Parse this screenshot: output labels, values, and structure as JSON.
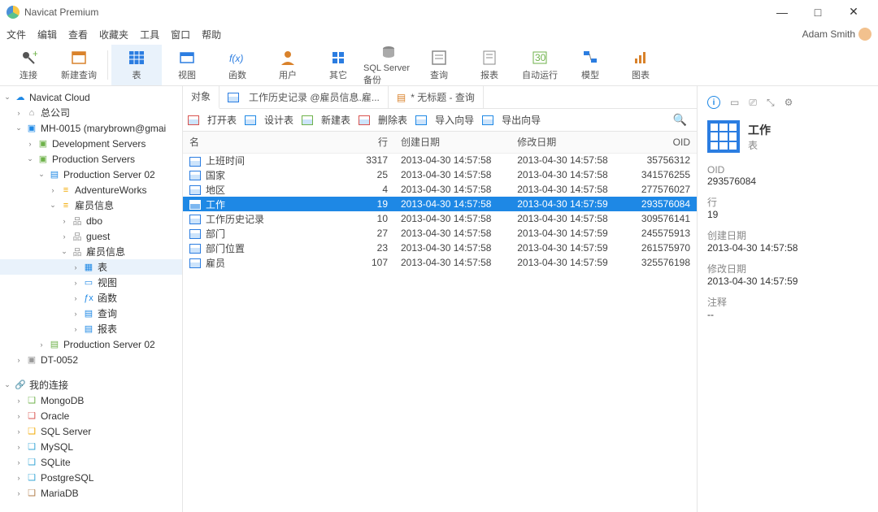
{
  "titlebar": {
    "title": "Navicat Premium"
  },
  "menubar": {
    "items": [
      "文件",
      "编辑",
      "查看",
      "收藏夹",
      "工具",
      "窗口",
      "帮助"
    ],
    "user": "Adam Smith"
  },
  "toolbar": [
    {
      "label": "连接",
      "icon": "plug-icon"
    },
    {
      "label": "新建查询",
      "icon": "query-icon"
    },
    {
      "label": "表",
      "icon": "table-icon",
      "active": true
    },
    {
      "label": "视图",
      "icon": "view-icon"
    },
    {
      "label": "函数",
      "icon": "fx-icon"
    },
    {
      "label": "用户",
      "icon": "user-icon"
    },
    {
      "label": "其它",
      "icon": "other-icon"
    },
    {
      "label": "SQL Server 备份",
      "icon": "backup-icon"
    },
    {
      "label": "查询",
      "icon": "query2-icon"
    },
    {
      "label": "报表",
      "icon": "report-icon"
    },
    {
      "label": "自动运行",
      "icon": "auto-icon"
    },
    {
      "label": "模型",
      "icon": "model-icon"
    },
    {
      "label": "图表",
      "icon": "chart-icon"
    }
  ],
  "tree": {
    "sections": [
      {
        "label": "Navicat Cloud",
        "icon": "cloud"
      },
      {
        "label": "总公司",
        "indent": 1,
        "icon": "org"
      },
      {
        "label": "MH-0015",
        "suffix": "(marybrown@gmai",
        "indent": 1,
        "icon": "laptop",
        "expanded": true
      },
      {
        "label": "Development Servers",
        "indent": 2,
        "icon": "folder"
      },
      {
        "label": "Production Servers",
        "indent": 2,
        "icon": "folder",
        "expanded": true
      },
      {
        "label": "Production Server 02",
        "indent": 3,
        "icon": "server",
        "expanded": true
      },
      {
        "label": "AdventureWorks",
        "indent": 4,
        "icon": "db"
      },
      {
        "label": "雇员信息",
        "indent": 4,
        "icon": "db",
        "expanded": true
      },
      {
        "label": "dbo",
        "indent": 5,
        "icon": "schema"
      },
      {
        "label": "guest",
        "indent": 5,
        "icon": "schema"
      },
      {
        "label": "雇员信息",
        "indent": 5,
        "icon": "schema",
        "expanded": true
      },
      {
        "label": "表",
        "indent": 6,
        "icon": "table",
        "selected": true
      },
      {
        "label": "视图",
        "indent": 6,
        "icon": "view"
      },
      {
        "label": "函数",
        "indent": 6,
        "icon": "fx"
      },
      {
        "label": "查询",
        "indent": 6,
        "icon": "query"
      },
      {
        "label": "报表",
        "indent": 6,
        "icon": "report"
      },
      {
        "label": "Production Server 02",
        "indent": 3,
        "icon": "server-green"
      },
      {
        "label": "DT-0052",
        "indent": 1,
        "icon": "laptop-grey"
      },
      {
        "spacer": true
      },
      {
        "label": "我的连接",
        "icon": "link",
        "expanded": true
      },
      {
        "label": "MongoDB",
        "indent": 1,
        "icon": "mongo"
      },
      {
        "label": "Oracle",
        "indent": 1,
        "icon": "oracle"
      },
      {
        "label": "SQL Server",
        "indent": 1,
        "icon": "mssql"
      },
      {
        "label": "MySQL",
        "indent": 1,
        "icon": "mysql"
      },
      {
        "label": "SQLite",
        "indent": 1,
        "icon": "sqlite"
      },
      {
        "label": "PostgreSQL",
        "indent": 1,
        "icon": "pg"
      },
      {
        "label": "MariaDB",
        "indent": 1,
        "icon": "maria"
      }
    ]
  },
  "tabs": [
    {
      "label": "对象",
      "active": true,
      "icon": "obj"
    },
    {
      "label": "工作历史记录 @雇员信息.雇...",
      "icon": "tbl"
    },
    {
      "label": "* 无标题 - 查询",
      "icon": "qry"
    }
  ],
  "subtoolbar": [
    {
      "label": "打开表",
      "icon": "open"
    },
    {
      "label": "设计表",
      "icon": "design"
    },
    {
      "label": "新建表",
      "icon": "new"
    },
    {
      "label": "删除表",
      "icon": "del"
    },
    {
      "label": "导入向导",
      "icon": "imp"
    },
    {
      "label": "导出向导",
      "icon": "exp"
    }
  ],
  "columns": [
    "名",
    "行",
    "创建日期",
    "修改日期",
    "OID"
  ],
  "rows": [
    {
      "name": "上班时间",
      "rows": 3317,
      "created": "2013-04-30 14:57:58",
      "modified": "2013-04-30 14:57:58",
      "oid": "35756312"
    },
    {
      "name": "国家",
      "rows": 25,
      "created": "2013-04-30 14:57:58",
      "modified": "2013-04-30 14:57:58",
      "oid": "341576255"
    },
    {
      "name": "地区",
      "rows": 4,
      "created": "2013-04-30 14:57:58",
      "modified": "2013-04-30 14:57:58",
      "oid": "277576027"
    },
    {
      "name": "工作",
      "rows": 19,
      "created": "2013-04-30 14:57:58",
      "modified": "2013-04-30 14:57:59",
      "oid": "293576084",
      "selected": true
    },
    {
      "name": "工作历史记录",
      "rows": 10,
      "created": "2013-04-30 14:57:58",
      "modified": "2013-04-30 14:57:58",
      "oid": "309576141"
    },
    {
      "name": "部门",
      "rows": 27,
      "created": "2013-04-30 14:57:58",
      "modified": "2013-04-30 14:57:59",
      "oid": "245575913"
    },
    {
      "name": "部门位置",
      "rows": 23,
      "created": "2013-04-30 14:57:58",
      "modified": "2013-04-30 14:57:59",
      "oid": "261575970"
    },
    {
      "name": "雇员",
      "rows": 107,
      "created": "2013-04-30 14:57:58",
      "modified": "2013-04-30 14:57:59",
      "oid": "325576198"
    }
  ],
  "details": {
    "title": "工作",
    "subtitle": "表",
    "fields": [
      {
        "k": "OID",
        "v": "293576084"
      },
      {
        "k": "行",
        "v": "19"
      },
      {
        "k": "创建日期",
        "v": "2013-04-30 14:57:58"
      },
      {
        "k": "修改日期",
        "v": "2013-04-30 14:57:59"
      },
      {
        "k": "注释",
        "v": "--"
      }
    ]
  },
  "colors": {
    "accent": "#1e88e5"
  }
}
